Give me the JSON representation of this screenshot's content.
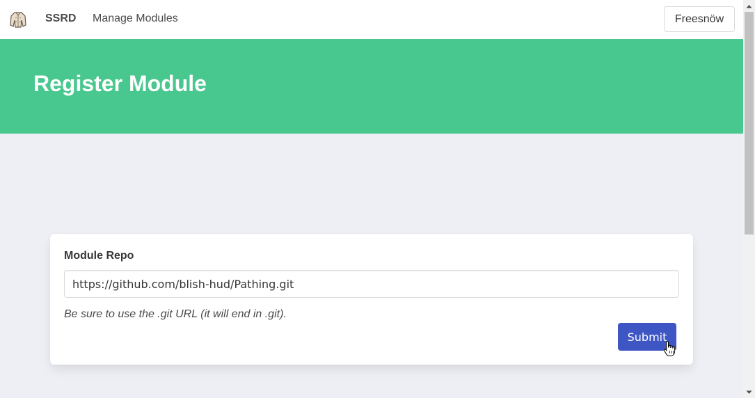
{
  "navbar": {
    "logo_icon": "armor-logo-icon",
    "brand": "SSRD",
    "nav_link": "Manage Modules",
    "user_button": "Freesnöw"
  },
  "hero": {
    "title": "Register Module",
    "background_color": "#48c78e"
  },
  "form": {
    "field_label": "Module Repo",
    "repo_value": "https://github.com/blish-hud/Pathing.git",
    "help_text": "Be sure to use the .git URL (it will end in .git).",
    "submit_label": "Submit",
    "submit_color": "#3e56c4"
  },
  "cursor": {
    "icon": "hand-pointer-icon"
  },
  "scrollbar": {
    "up_icon": "arrow-up-icon",
    "down_icon": "arrow-down-icon"
  }
}
